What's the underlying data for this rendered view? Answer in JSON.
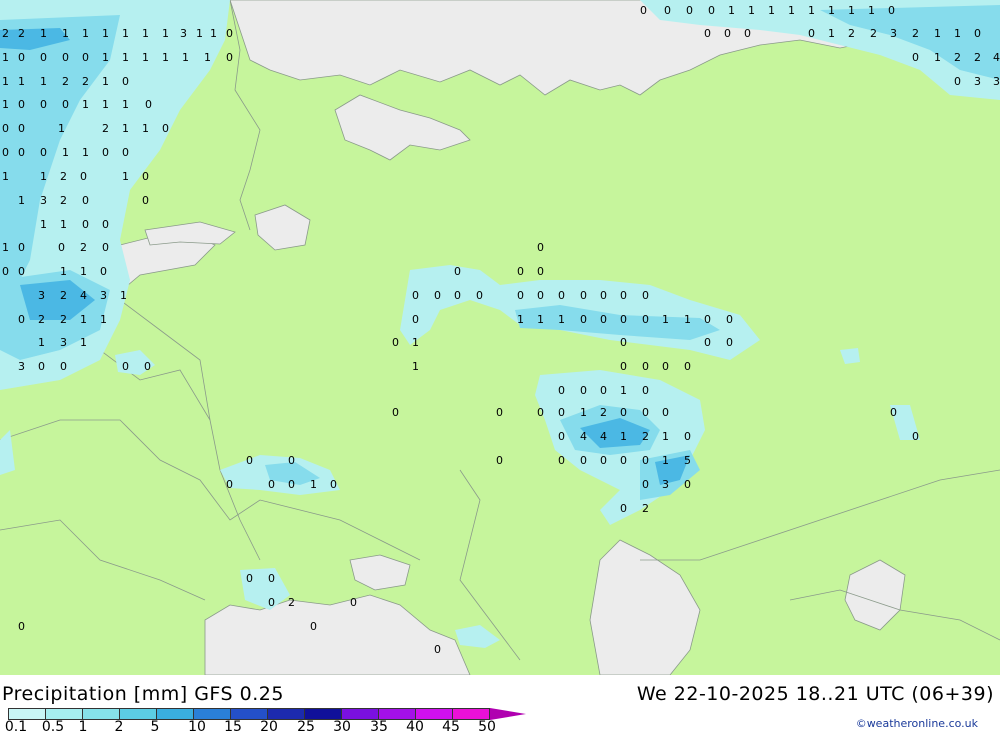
{
  "title": {
    "product": "Precipitation [mm]",
    "model": "GFS 0.25",
    "valid_time": "We 22-10-2025 18..21 UTC (06+39)"
  },
  "legend": {
    "labels": [
      "0.1",
      "0.5",
      "1",
      "2",
      "5",
      "10",
      "15",
      "20",
      "25",
      "30",
      "35",
      "40",
      "45",
      "50"
    ],
    "colors": [
      "#c8f6f6",
      "#a6eef0",
      "#86e2ea",
      "#5ccde4",
      "#3aaee0",
      "#2a7fd8",
      "#2450c8",
      "#1c2aae",
      "#10109a",
      "#7a10e0",
      "#a410e8",
      "#d010ee",
      "#ea10d8",
      "#c010b0"
    ]
  },
  "credit": "©weatheronline.co.uk",
  "colors": {
    "land": "#c6f59c",
    "sea": "#ececec",
    "border": "#8a9a8a",
    "precip_light": "#b6f0f0",
    "precip_mid": "#86dcec",
    "precip_heavy": "#4bb8e4"
  },
  "map_values": {
    "top_left": [
      "2",
      "2",
      "1",
      "1",
      "1",
      "1",
      "1",
      "1",
      "1",
      "3",
      "1",
      "1",
      "0"
    ],
    "row2": [
      "1",
      "0",
      "0",
      "0",
      "0",
      "1",
      "1",
      "1",
      "1",
      "1",
      "1",
      "0"
    ],
    "row3": [
      "1",
      "1",
      "1",
      "2",
      "2",
      "1",
      "0"
    ],
    "row4": [
      "1",
      "0",
      "0",
      "0",
      "1",
      "1",
      "1",
      "0"
    ],
    "row5": [
      "0",
      "0",
      "1",
      "2",
      "1",
      "1",
      "0"
    ],
    "row6": [
      "0",
      "0",
      "0",
      "1",
      "1",
      "0",
      "0"
    ],
    "row7": [
      "1",
      "1",
      "2",
      "0",
      "1",
      "0"
    ],
    "row8": [
      "1",
      "3",
      "2",
      "0",
      "0"
    ],
    "row9": [
      "1",
      "1",
      "0",
      "0"
    ],
    "row10": [
      "1",
      "0",
      "0",
      "2",
      "0"
    ],
    "row11": [
      "0",
      "0",
      "1",
      "1",
      "0"
    ],
    "row12": [
      "3",
      "2",
      "4",
      "3",
      "1"
    ],
    "row13": [
      "0",
      "2",
      "2",
      "1",
      "1"
    ],
    "row14": [
      "1",
      "3",
      "1"
    ],
    "row15": [
      "3",
      "0",
      "0",
      "0",
      "0"
    ],
    "top_right_a": [
      "0",
      "0",
      "0",
      "0",
      "1",
      "1",
      "1",
      "1",
      "1",
      "1",
      "1",
      "1",
      "0"
    ],
    "top_right_b": [
      "0",
      "0",
      "0"
    ],
    "top_right_c": [
      "0",
      "1",
      "2",
      "2",
      "3",
      "2",
      "1",
      "1",
      "0"
    ],
    "top_right_d": [
      "0",
      "1",
      "2",
      "2",
      "4"
    ],
    "top_right_e": [
      "0",
      "3",
      "3"
    ],
    "central_1": [
      "0"
    ],
    "central_2": [
      "0",
      "0",
      "0"
    ],
    "central_3": [
      "0",
      "0",
      "0",
      "0",
      "0",
      "0",
      "0",
      "0",
      "0",
      "0",
      "0"
    ],
    "central_4": [
      "0",
      "1",
      "1",
      "1",
      "0",
      "0",
      "0",
      "0",
      "1",
      "1",
      "0",
      "0"
    ],
    "central_5": [
      "0",
      "1",
      "0",
      "0",
      "0"
    ],
    "central_6": [
      "1",
      "0",
      "0",
      "0",
      "0"
    ],
    "volga_1": [
      "0",
      "0",
      "0",
      "1",
      "0"
    ],
    "volga_2": [
      "0",
      "0",
      "0",
      "0",
      "1",
      "2",
      "0",
      "0",
      "0"
    ],
    "volga_3": [
      "0",
      "4",
      "4",
      "1",
      "2",
      "1",
      "0"
    ],
    "volga_4": [
      "0",
      "0",
      "0",
      "0",
      "0",
      "0",
      "1",
      "5"
    ],
    "volga_5": [
      "0",
      "3",
      "0"
    ],
    "volga_6": [
      "0",
      "2"
    ],
    "ukraine_1": [
      "0",
      "0"
    ],
    "ukraine_2": [
      "0",
      "0",
      "0",
      "1",
      "0"
    ],
    "south": [
      "0",
      "0",
      "0",
      "2",
      "0",
      "0",
      "0",
      "0"
    ],
    "east": [
      "0",
      "0"
    ]
  }
}
